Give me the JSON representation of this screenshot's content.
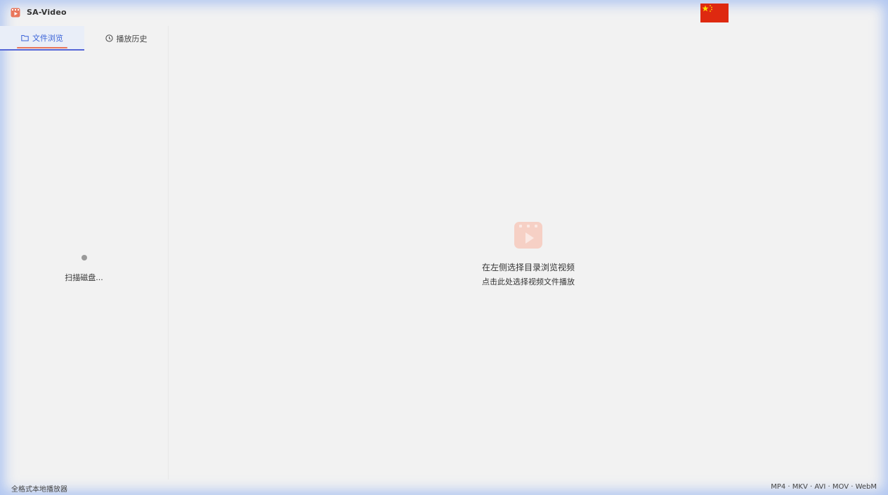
{
  "app": {
    "title": "SA-Video",
    "logo_icon": "video-app-icon",
    "language_flag": "china-flag-icon"
  },
  "sidebar": {
    "tabs": [
      {
        "label": "文件浏览",
        "icon": "folder-icon",
        "active": true
      },
      {
        "label": "播放历史",
        "icon": "clock-icon",
        "active": false
      }
    ],
    "loading_text": "扫描磁盘..."
  },
  "main": {
    "empty_title": "在左侧选择目录浏览视频",
    "empty_hint": "点击此处选择视频文件播放",
    "empty_icon": "video-placeholder-icon"
  },
  "footer": {
    "left_text": "全格式本地播放器",
    "formats_text": "MP4 · MKV · AVI · MOV · WebM"
  },
  "colors": {
    "accent": "#3b63d8",
    "brand": "#e9775c",
    "flag_red": "#de2910",
    "flag_yellow": "#ffde00"
  }
}
